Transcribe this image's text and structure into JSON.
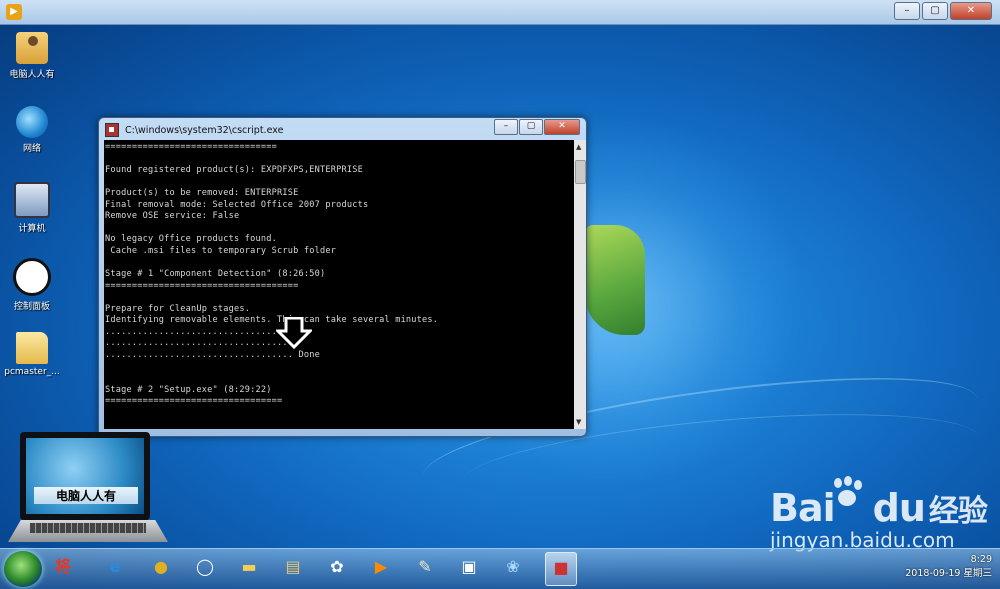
{
  "top_window": {
    "title": "",
    "buttons": {
      "minimize": "–",
      "maximize": "▢",
      "close": "✕"
    }
  },
  "desktop_icons": [
    {
      "label": "电脑人人有",
      "icon": "user-folder-icon"
    },
    {
      "label": "网络",
      "icon": "network-icon"
    },
    {
      "label": "计算机",
      "icon": "computer-icon"
    },
    {
      "label": "控制面板",
      "icon": "panda-control-panel-icon"
    },
    {
      "label": "pcmaster_...",
      "icon": "folder-icon"
    }
  ],
  "console": {
    "title": "C:\\windows\\system32\\cscript.exe",
    "buttons": {
      "minimize": "–",
      "maximize": "▢",
      "close": "✕"
    },
    "lines": [
      "================================",
      "",
      "Found registered product(s): EXPDFXPS,ENTERPRISE",
      "",
      "Product(s) to be removed: ENTERPRISE",
      "Final removal mode: Selected Office 2007 products",
      "Remove OSE service: False",
      "",
      "No legacy Office products found.",
      " Cache .msi files to temporary Scrub folder",
      "",
      "Stage # 1 \"Component Detection\" (8:26:50)",
      "====================================",
      "",
      "Prepare for CleanUp stages.",
      "Identifying removable elements. This can take several minutes.",
      "....................................",
      "....................................",
      "................................... Done",
      "",
      "",
      "Stage # 2 \"Setup.exe\" (8:29:22)",
      "================================="
    ]
  },
  "logo": {
    "title": "电脑人人有"
  },
  "watermark": {
    "brand": "Bai",
    "brand_suffix": "du",
    "cn": "经验",
    "url": "jingyan.baidu.com"
  },
  "taskbar": {
    "items": [
      {
        "name": "start-button"
      },
      {
        "name": "taskbar-app-jiang",
        "glyph": "将",
        "color": "#e23a2a"
      },
      {
        "name": "taskbar-ie",
        "glyph": "e",
        "color": "#2a8ae0"
      },
      {
        "name": "taskbar-chrome",
        "glyph": "●",
        "color": "#e0b020"
      },
      {
        "name": "taskbar-qq",
        "glyph": "◯",
        "color": "#ffffff"
      },
      {
        "name": "taskbar-folder-yellow",
        "glyph": "▬",
        "color": "#f2cf52"
      },
      {
        "name": "taskbar-explorer",
        "glyph": "▤",
        "color": "#e9c66a"
      },
      {
        "name": "taskbar-pinwheel",
        "glyph": "✿",
        "color": "#ffffff"
      },
      {
        "name": "taskbar-media",
        "glyph": "▶",
        "color": "#ff8a00"
      },
      {
        "name": "taskbar-paint",
        "glyph": "✎",
        "color": "#f0e6c8"
      },
      {
        "name": "taskbar-box",
        "glyph": "▣",
        "color": "#ffffff"
      },
      {
        "name": "taskbar-clover",
        "glyph": "❀",
        "color": "#a8d8ff"
      },
      {
        "name": "taskbar-cscript",
        "glyph": "■",
        "color": "#c33"
      }
    ]
  },
  "clock": {
    "time": "8:29",
    "date": "2018-09-19 星期三"
  }
}
